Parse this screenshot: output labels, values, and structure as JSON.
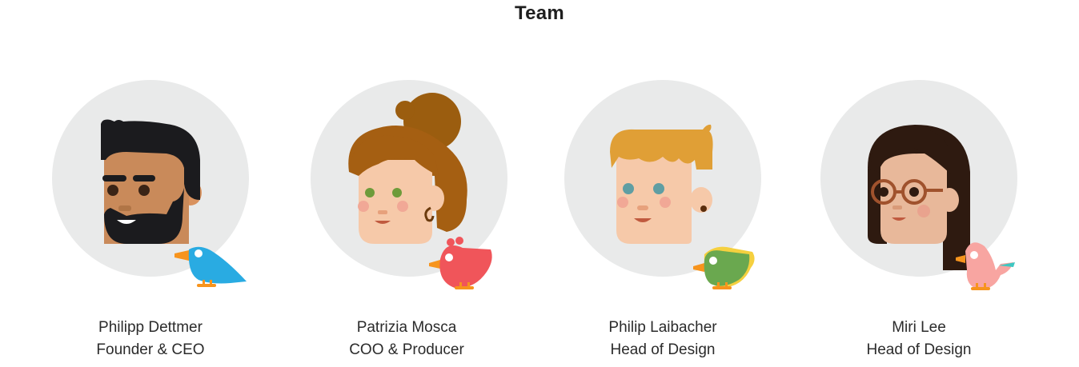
{
  "page": {
    "title": "Team"
  },
  "team": [
    {
      "name": "Philipp Dettmer",
      "role": "Founder & CEO",
      "avatar_icon": "bearded-man-with-blue-bird-icon"
    },
    {
      "name": "Patrizia Mosca",
      "role": "COO & Producer",
      "avatar_icon": "curly-haired-woman-with-red-bird-icon"
    },
    {
      "name": "Philip Laibacher",
      "role": "Head of Design",
      "avatar_icon": "blond-man-with-green-bird-icon"
    },
    {
      "name": "Miri Lee",
      "role": "Head of Design",
      "avatar_icon": "woman-with-glasses-and-pink-bird-icon"
    }
  ],
  "colors": {
    "circle_background": "#e9eaea",
    "text": "#2b2b2b"
  }
}
